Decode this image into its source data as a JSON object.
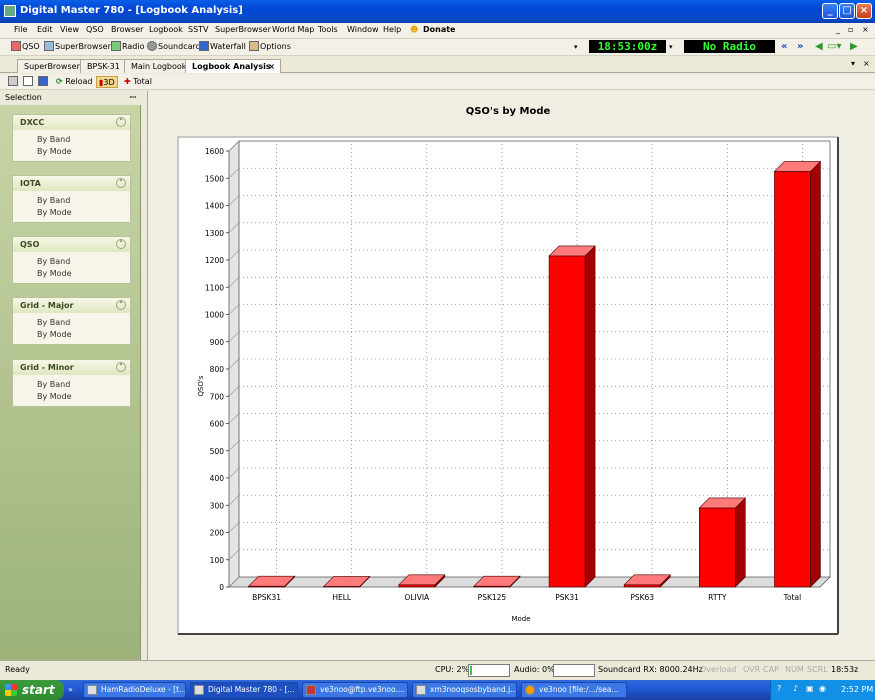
{
  "window": {
    "title": "Digital Master 780 - [Logbook Analysis]"
  },
  "menu": [
    "File",
    "Edit",
    "View",
    "QSO",
    "Browser",
    "Logbook",
    "SSTV",
    "SuperBrowser",
    "World Map",
    "Tools",
    "Window",
    "Help",
    "Donate"
  ],
  "toolbar": {
    "items": [
      "QSO",
      "SuperBrowser",
      "Radio",
      "Soundcard",
      "Waterfall",
      "Options"
    ],
    "clock": "18:53:00z",
    "radio_status": "No Radio"
  },
  "tabs": [
    "SuperBrowser",
    "BPSK-31",
    "Main Logbook",
    "Logbook Analysis"
  ],
  "subtoolbar": {
    "reload": "Reload",
    "threeD": "3D",
    "total": "Total"
  },
  "sidebar": {
    "header": "Selection",
    "panels": [
      {
        "title": "DXCC",
        "links": [
          "By Band",
          "By Mode"
        ]
      },
      {
        "title": "IOTA",
        "links": [
          "By Band",
          "By Mode"
        ]
      },
      {
        "title": "QSO",
        "links": [
          "By Band",
          "By Mode"
        ]
      },
      {
        "title": "Grid - Major",
        "links": [
          "By Band",
          "By Mode"
        ]
      },
      {
        "title": "Grid - Minor",
        "links": [
          "By Band",
          "By Mode"
        ]
      }
    ]
  },
  "chart_data": {
    "type": "bar",
    "title": "QSO's by Mode",
    "xlabel": "Mode",
    "ylabel": "QSO's",
    "categories": [
      "BPSK31",
      "HELL",
      "OLIVIA",
      "PSK125",
      "PSK31",
      "PSK63",
      "RTTY",
      "Total"
    ],
    "values": [
      3,
      2,
      8,
      3,
      1215,
      8,
      290,
      1525
    ],
    "ylim": [
      0,
      1600
    ],
    "yticks": [
      0,
      100,
      200,
      300,
      400,
      500,
      600,
      700,
      800,
      900,
      1000,
      1100,
      1200,
      1300,
      1400,
      1500,
      1600
    ],
    "grid": true,
    "style": "3d",
    "bar_color": "#ff0000"
  },
  "status": {
    "ready": "Ready",
    "cpu": "CPU: 2%",
    "audio": "Audio: 0%",
    "soundcard": "Soundcard RX: 8000.24Hz",
    "overload": "Overload",
    "ovr": "OVR",
    "cap": "CAP",
    "num": "NUM",
    "scrl": "SCRL",
    "time": "18:53z"
  },
  "taskbar": {
    "start": "start",
    "buttons": [
      "HamRadioDeluxe - [t...",
      "Digital Master 780 - [...",
      "ve3noo@ftp.ve3noo....",
      "xm3nooqsosbyband.j...",
      "ve3noo [file:/.../sea..."
    ],
    "clock": "2:52 PM"
  }
}
